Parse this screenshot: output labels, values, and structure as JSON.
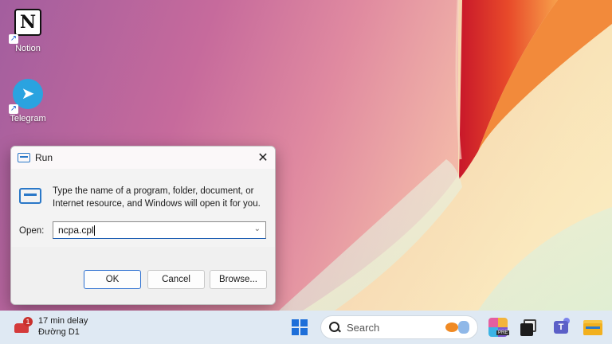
{
  "desktop": {
    "icons": [
      {
        "label": "Notion",
        "glyph": "N",
        "icon": "notion-icon"
      },
      {
        "label": "Telegram",
        "glyph": "➤",
        "icon": "telegram-icon"
      }
    ]
  },
  "run_dialog": {
    "title": "Run",
    "close_glyph": "✕",
    "description": "Type the name of a program, folder, document, or Internet resource, and Windows will open it for you.",
    "open_label": "Open:",
    "open_value": "ncpa.cpl",
    "dropdown_glyph": "⌄",
    "ok_label": "OK",
    "cancel_label": "Cancel",
    "browse_label": "Browse..."
  },
  "taskbar": {
    "widget": {
      "badge": "1",
      "line1": "17 min delay",
      "line2": "Đường D1"
    },
    "search_placeholder": "Search",
    "copilot_badge": "PRE",
    "teams_glyph": "T"
  },
  "colors": {
    "accent": "#1e6fd9",
    "taskbar_bg": "#dfe9f3",
    "dialog_bg": "#f3f3f3"
  }
}
